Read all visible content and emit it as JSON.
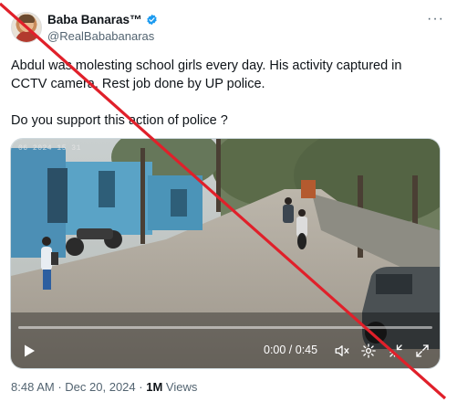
{
  "author": {
    "display_name": "Baba Banaras™",
    "handle": "@RealBababanaras"
  },
  "tweet": {
    "text": "Abdul was molesting school girls every day. His activity captured in CCTV camera. Rest job done by UP police.\n\nDo you support this action of police ?"
  },
  "video": {
    "cctv_timestamp": "06 2024  15 31",
    "time_display": "0:00 / 0:45",
    "progress": 0
  },
  "meta": {
    "time": "8:48 AM",
    "date": "Dec 20, 2024",
    "views_count": "1M",
    "views_label": "Views",
    "separator": "·"
  },
  "colors": {
    "verified": "#1d9bf0",
    "overlay_x": "#e0202a",
    "muted_text": "#536471"
  },
  "icons": [
    "verified-badge-icon",
    "more-options-icon",
    "play-icon",
    "volume-muted-icon",
    "settings-icon",
    "fullscreen-exit-icon",
    "fullscreen-icon"
  ]
}
